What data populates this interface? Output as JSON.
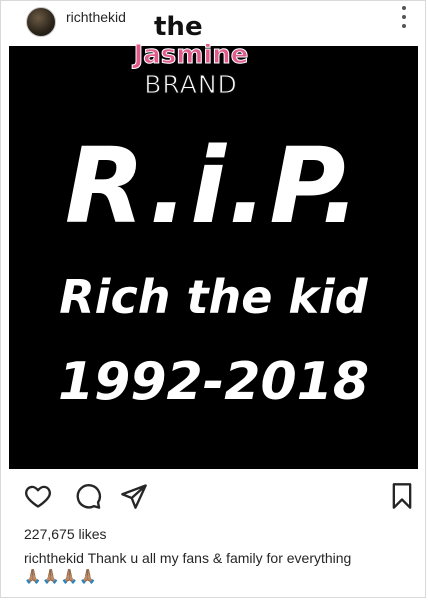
{
  "post": {
    "username": "richthekid",
    "likes": "227,675 likes",
    "caption_user": "richthekid",
    "caption_text": "Thank u all my fans & family for everything",
    "caption_emojis": "🙏🏽🙏🏽🙏🏽🙏🏽"
  },
  "image": {
    "headline": "R.i.P.",
    "name_line": "Rich the kid",
    "dates_line": "1992-2018",
    "background": "#000000",
    "text_color": "#ffffff"
  },
  "watermark": {
    "line1": "the",
    "line2": "Jasmine",
    "line3": "BRAND",
    "accent": "#e05a8c"
  },
  "icons": {
    "more": "more-options-icon",
    "like": "heart-icon",
    "comment": "comment-icon",
    "share": "share-icon",
    "save": "bookmark-icon"
  }
}
